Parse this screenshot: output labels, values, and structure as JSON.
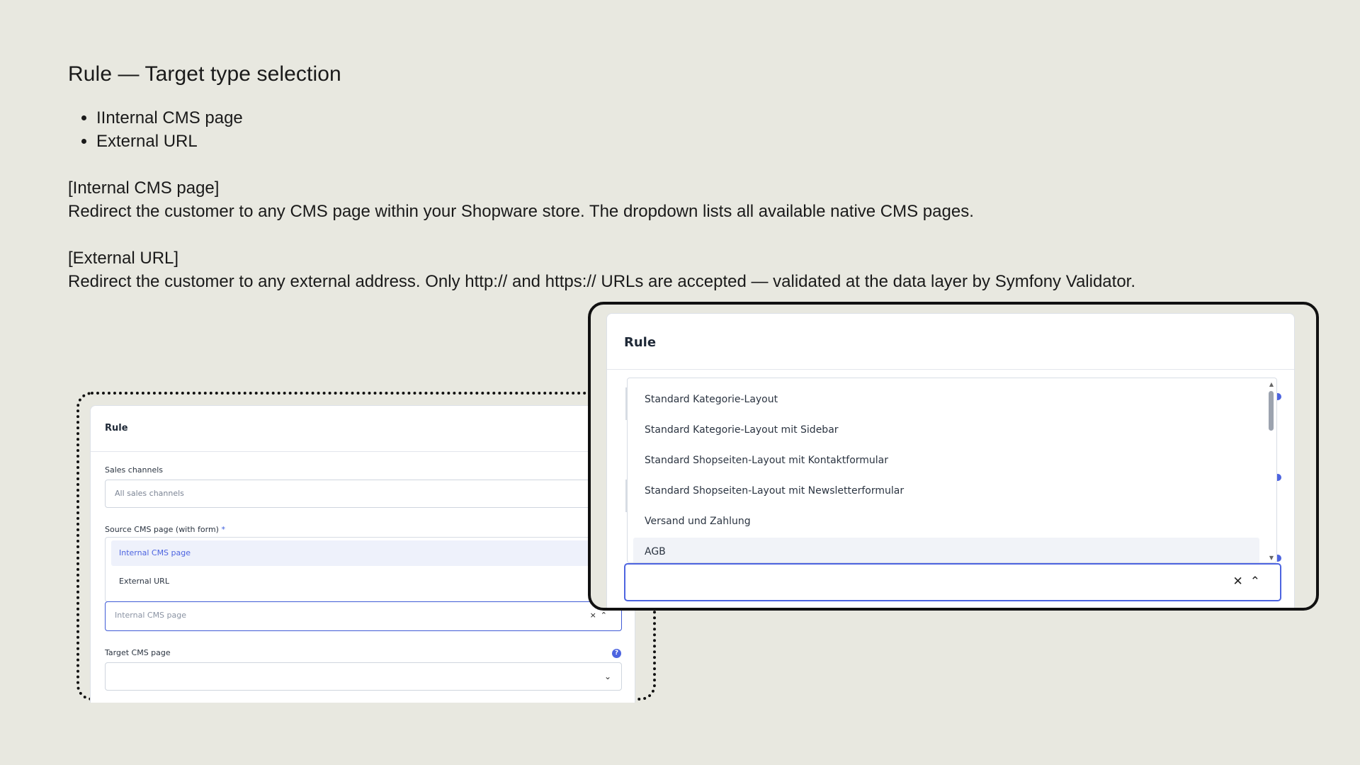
{
  "doc": {
    "title": "Rule — Target type selection",
    "bullets": [
      "IInternal CMS page",
      "External URL"
    ],
    "section_internal_title": "[Internal CMS page]",
    "section_internal_text": "Redirect the customer to any CMS page within your Shopware store. The dropdown lists all available native CMS pages.",
    "section_external_title": "[External URL]",
    "section_external_text": "Redirect the customer to any external address. Only http:// and https:// URLs are accepted — validated at the data layer by Symfony Validator."
  },
  "left_card": {
    "title": "Rule",
    "sales_channels_label": "Sales channels",
    "sales_channels_placeholder": "All sales channels",
    "source_label": "Source CMS page (with form)",
    "required_mark": "*",
    "options": [
      "Internal CMS page",
      "External URL"
    ],
    "target_type_value": "Internal CMS page",
    "clear_glyph": "×",
    "chevron_up_glyph": "⌃",
    "target_label": "Target CMS page",
    "help_glyph": "?",
    "chevron_down_glyph": "⌄"
  },
  "right_card": {
    "title": "Rule",
    "options": [
      "Standard Kategorie-Layout",
      "Standard Kategorie-Layout mit Sidebar",
      "Standard Shopseiten-Layout mit Kontaktformular",
      "Standard Shopseiten-Layout mit Newsletterformular",
      "Versand und Zahlung",
      "AGB"
    ],
    "hovered_option": "AGB",
    "clear_glyph": "✕",
    "chevron_up_glyph": "⌃"
  },
  "colors": {
    "accent": "#4d64e0",
    "background": "#e8e8e0",
    "active_option_bg": "#eef1fb"
  },
  "icons": [
    "close-icon",
    "chevron-up-icon",
    "chevron-down-icon",
    "help-icon",
    "scroll-up-icon",
    "scroll-down-icon"
  ]
}
